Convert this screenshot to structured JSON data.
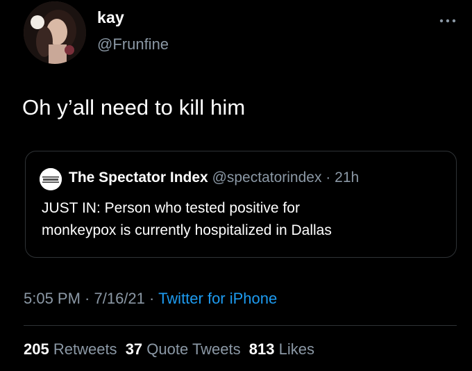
{
  "tweet": {
    "display_name": "kay",
    "handle": "@Frunfine",
    "text": "Oh y’all need to kill him",
    "more_icon": "more-horizontal-icon",
    "avatar_icon": "profile-photo"
  },
  "quote_tweet": {
    "display_name": "The Spectator Index",
    "handle": "@spectatorindex",
    "separator": " · ",
    "age": "21h",
    "text_line1": "JUST IN: Person who tested positive for",
    "text_line2": "monkeypox is currently hospitalized in Dallas",
    "avatar_icon": "spectator-index-logo"
  },
  "meta": {
    "time": "5:05 PM",
    "separator": " · ",
    "date": "7/16/21",
    "source": "Twitter for iPhone"
  },
  "stats": {
    "retweets_count": "205",
    "retweets_label": "Retweets",
    "quotes_count": "37",
    "quotes_label": "Quote Tweets",
    "likes_count": "813",
    "likes_label": "Likes"
  },
  "colors": {
    "background": "#000000",
    "primary_text": "#ffffff",
    "secondary_text": "#8b98a5",
    "link": "#1d9bf0",
    "border": "#2f3336"
  }
}
